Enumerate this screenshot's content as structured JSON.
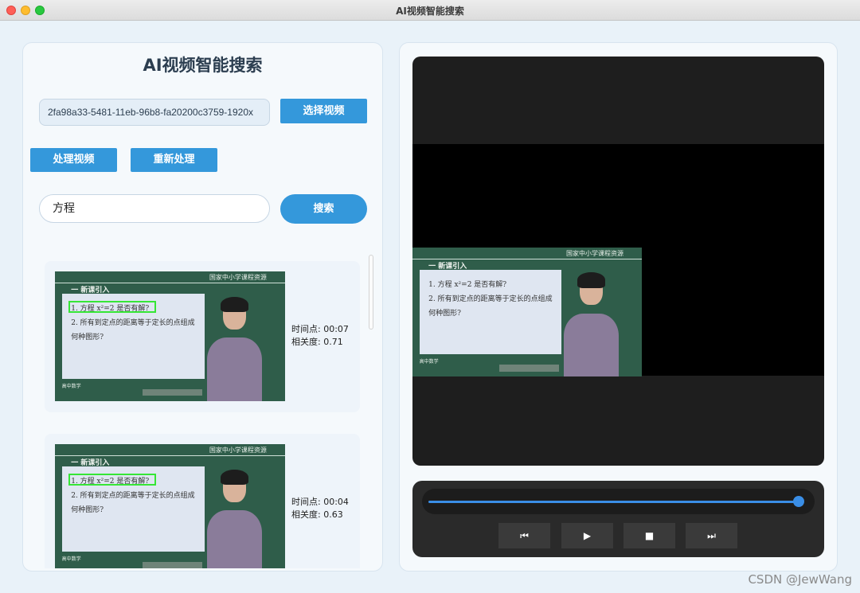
{
  "window": {
    "title": "AI视频智能搜索"
  },
  "app": {
    "title": "AI视频智能搜索",
    "file_path": "2fa98a33-5481-11eb-96b8-fa20200c3759-1920x",
    "select_button": "选择视频",
    "process_button": "处理视频",
    "reprocess_button": "重新处理",
    "search_value": "方程",
    "search_button": "搜索"
  },
  "results": [
    {
      "time_label": "时间点: 00:07",
      "score_label": "相关度: 0.71"
    },
    {
      "time_label": "时间点: 00:04",
      "score_label": "相关度: 0.63"
    }
  ],
  "lesson_frame": {
    "brand": "国家中小学课程资源",
    "heading": "一  新课引入",
    "line1": "1. 方程 x²=2 是否有解?",
    "line2": "2. 所有到定点的距离等于定长的点组成",
    "line3": "何种图形?",
    "footer": "高中数学"
  },
  "player": {
    "progress_fraction": 0.99,
    "buttons": [
      "⏮",
      "▶",
      "■",
      "⏭"
    ]
  },
  "watermark": "CSDN @JewWang",
  "colors": {
    "accent": "#3498db",
    "highlight": "#36e636",
    "player_bg": "#1e1e1e"
  }
}
